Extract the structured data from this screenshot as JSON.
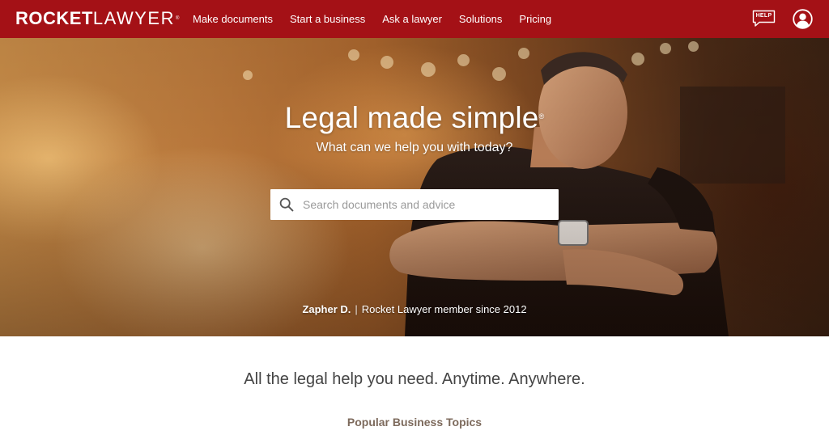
{
  "brand": {
    "logo_bold": "ROCKET",
    "logo_light": "LAWYER",
    "logo_mark": "®",
    "color_header": "#a41116"
  },
  "nav": {
    "links": [
      {
        "label": "Make documents"
      },
      {
        "label": "Start a business"
      },
      {
        "label": "Ask a lawyer"
      },
      {
        "label": "Solutions"
      },
      {
        "label": "Pricing"
      }
    ],
    "help_label": "HELP",
    "help_icon": "speech-bubble-icon",
    "account_icon": "user-account-icon"
  },
  "hero": {
    "title": "Legal made simple",
    "title_mark": "®",
    "subtitle": "What can we help you with today?",
    "search": {
      "placeholder": "Search documents and advice",
      "value": "",
      "icon": "search-icon"
    },
    "testimonial": {
      "name": "Zapher D.",
      "separator": "|",
      "caption": "Rocket Lawyer member since 2012"
    }
  },
  "main": {
    "tagline": "All the legal help you need. Anytime. Anywhere.",
    "topics_heading": "Popular Business Topics"
  }
}
